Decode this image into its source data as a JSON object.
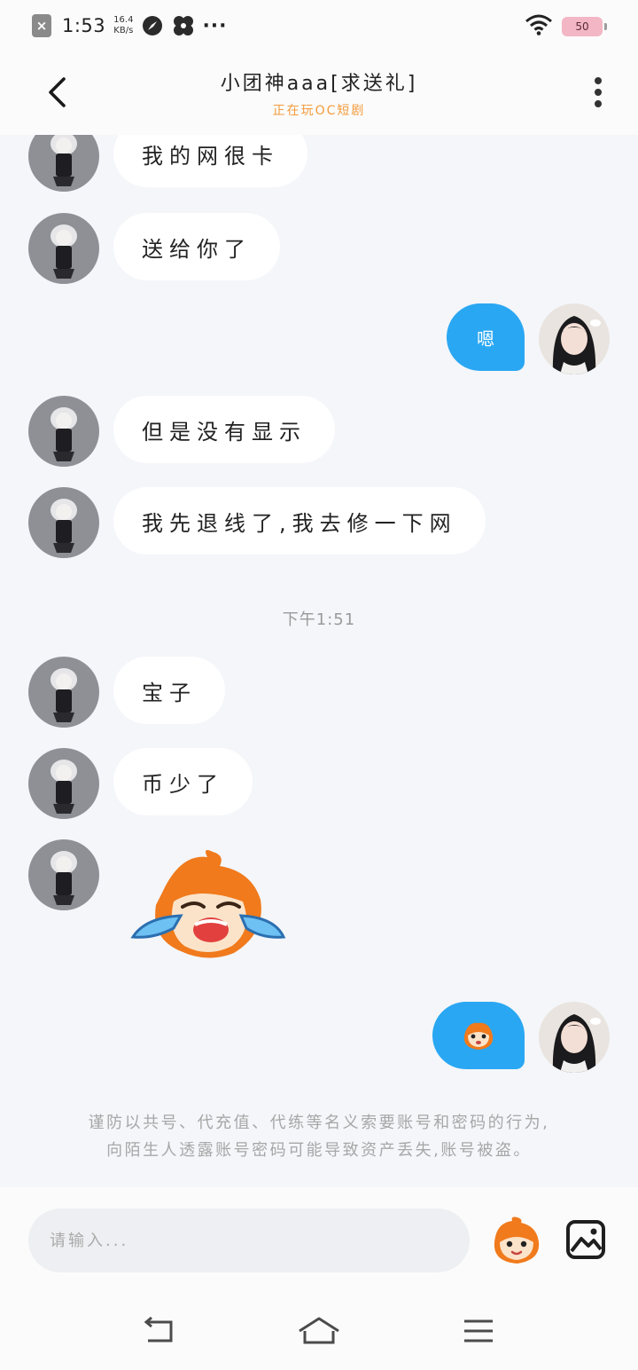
{
  "status_bar": {
    "time": "1:53",
    "speed_value": "16.4",
    "speed_unit": "KB/s",
    "more": "···",
    "battery": "50"
  },
  "header": {
    "title": "小团神aaa[求送礼]",
    "subtitle": "正在玩OC短剧"
  },
  "messages": [
    {
      "side": "in",
      "text": "我的网很卡"
    },
    {
      "side": "in",
      "text": "送给你了"
    },
    {
      "side": "out",
      "text": "嗯"
    },
    {
      "side": "in",
      "text": "但是没有显示"
    },
    {
      "side": "in",
      "text": "我先退线了,我去修一下网"
    },
    {
      "side": "time",
      "text": "下午1:51"
    },
    {
      "side": "in",
      "text": "宝子"
    },
    {
      "side": "in",
      "text": "币少了"
    },
    {
      "side": "in",
      "sticker": "crying-mascot-sticker"
    },
    {
      "side": "out",
      "sticker": "small-mascot-sticker"
    }
  ],
  "warning": {
    "line1": "谨防以共号、代充值、代练等名义索要账号和密码的行为,",
    "line2": "向陌生人透露账号密码可能导致资产丢失,账号被盗。"
  },
  "input": {
    "placeholder": "请输入..."
  },
  "colors": {
    "accent_blue": "#2aa7f2",
    "subtitle_orange": "#f39b3c",
    "background": "#f4f6fa"
  }
}
